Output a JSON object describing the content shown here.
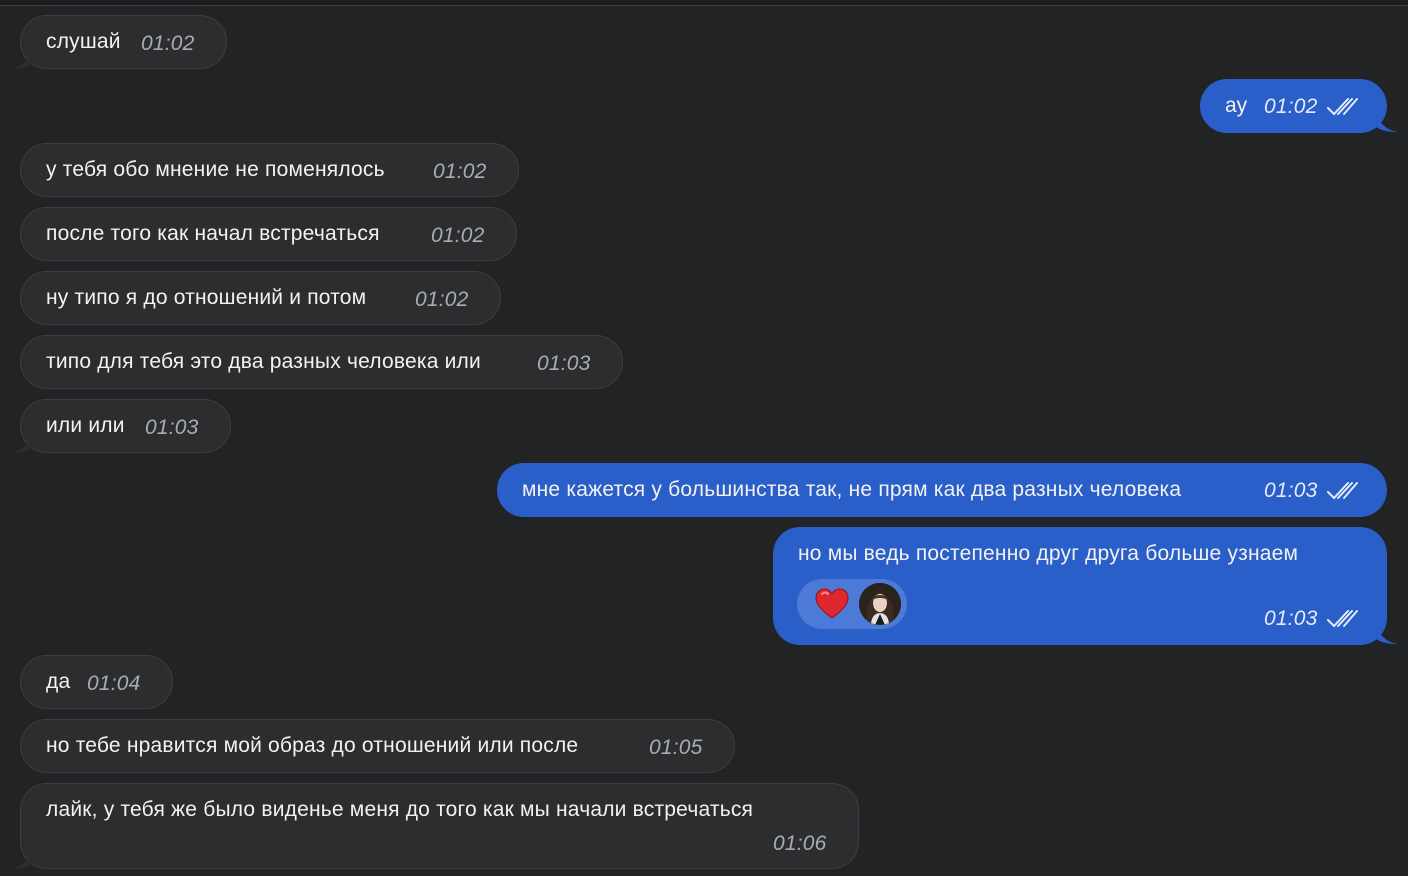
{
  "messages": [
    {
      "id": "m1",
      "direction": "in",
      "text": "слушай",
      "time": "01:02"
    },
    {
      "id": "m2",
      "direction": "out",
      "text": "ау",
      "time": "01:02",
      "read": true
    },
    {
      "id": "m3",
      "direction": "in",
      "text": "у тебя обо мнение не поменялось",
      "time": "01:02"
    },
    {
      "id": "m4",
      "direction": "in",
      "text": "после того как начал встречаться",
      "time": "01:02"
    },
    {
      "id": "m5",
      "direction": "in",
      "text": "ну типо я до отношений и потом",
      "time": "01:02"
    },
    {
      "id": "m6",
      "direction": "in",
      "text": "типо для тебя это два разных человека или",
      "time": "01:03"
    },
    {
      "id": "m7",
      "direction": "in",
      "text": "или или",
      "time": "01:03"
    },
    {
      "id": "m8",
      "direction": "out",
      "text": "мне кажется у большинства так, не прям как два разных человека",
      "time": "01:03",
      "read": true
    },
    {
      "id": "m9",
      "direction": "out",
      "text": "но мы ведь постепенно друг друга больше узнаем",
      "time": "01:03",
      "read": true,
      "reaction": {
        "emoji": "heart-icon",
        "by": "avatar"
      }
    },
    {
      "id": "m10",
      "direction": "in",
      "text": "да",
      "time": "01:04"
    },
    {
      "id": "m11",
      "direction": "in",
      "text": "но тебе нравится мой образ до отношений или после",
      "time": "01:05"
    },
    {
      "id": "m12",
      "direction": "in",
      "text": "лайк, у тебя же было виденье меня до того как мы начали встречаться",
      "time": "01:06"
    }
  ],
  "colors": {
    "background": "#212325",
    "incoming_bubble": "#2c2d2f",
    "outgoing_bubble": "#2a5ec9",
    "heart": "#e0262f"
  }
}
